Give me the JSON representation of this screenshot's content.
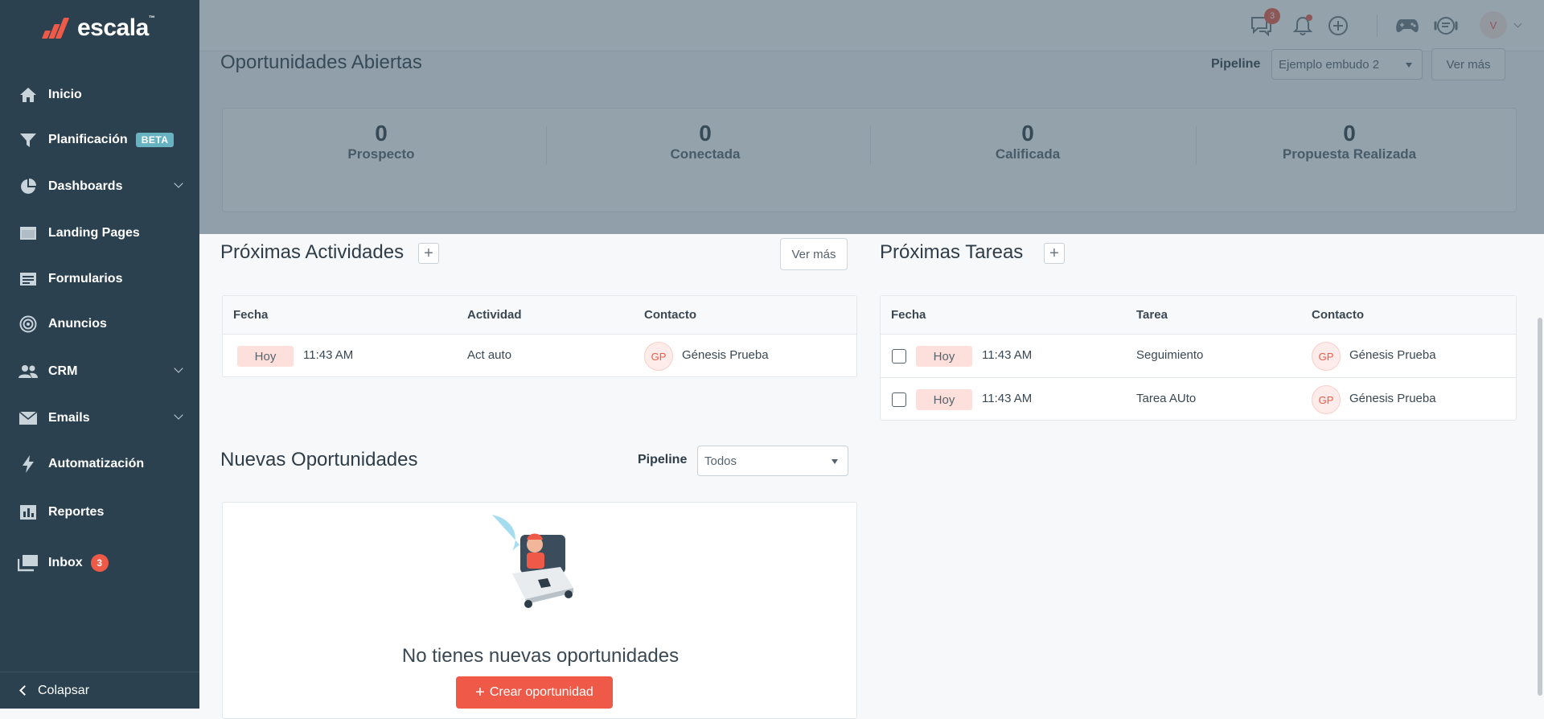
{
  "brand": {
    "logo_text": "escala",
    "logo_tm": "™"
  },
  "sidebar": {
    "items": [
      {
        "label": "Inicio",
        "icon": "home-icon"
      },
      {
        "label": "Planificación",
        "icon": "funnel-icon",
        "badge": "BETA"
      },
      {
        "label": "Dashboards",
        "icon": "pie-chart-icon",
        "chevron": true
      },
      {
        "label": "Landing Pages",
        "icon": "landing-page-icon"
      },
      {
        "label": "Formularios",
        "icon": "form-icon"
      },
      {
        "label": "Anuncios",
        "icon": "target-icon"
      },
      {
        "label": "CRM",
        "icon": "users-icon",
        "chevron": true
      },
      {
        "label": "Emails",
        "icon": "envelope-icon",
        "chevron": true
      },
      {
        "label": "Automatización",
        "icon": "bolt-icon"
      },
      {
        "label": "Reportes",
        "icon": "report-icon"
      },
      {
        "label": "Inbox",
        "icon": "inbox-icon",
        "count": "3"
      }
    ],
    "collapse_label": "Colapsar"
  },
  "topbar": {
    "chat_badge": "3",
    "avatar_initial": "V"
  },
  "open_opportunities": {
    "title": "Oportunidades Abiertas",
    "pipeline_label": "Pipeline",
    "pipeline_value": "Ejemplo embudo 2",
    "view_more": "Ver más",
    "stages": [
      {
        "count": "0",
        "label": "Prospecto"
      },
      {
        "count": "0",
        "label": "Conectada"
      },
      {
        "count": "0",
        "label": "Calificada"
      },
      {
        "count": "0",
        "label": "Propuesta Realizada"
      }
    ]
  },
  "activities": {
    "title": "Próximas Actividades",
    "view_more": "Ver más",
    "columns": [
      "Fecha",
      "Actividad",
      "Contacto"
    ],
    "rows": [
      {
        "day": "Hoy",
        "time": "11:43 AM",
        "name": "Act auto",
        "contact_initials": "GP",
        "contact": "Génesis Prueba"
      }
    ]
  },
  "tasks": {
    "title": "Próximas Tareas",
    "columns": [
      "Fecha",
      "Tarea",
      "Contacto"
    ],
    "rows": [
      {
        "day": "Hoy",
        "time": "11:43 AM",
        "name": "Seguimiento",
        "contact_initials": "GP",
        "contact": "Génesis Prueba"
      },
      {
        "day": "Hoy",
        "time": "11:43 AM",
        "name": "Tarea AUto",
        "contact_initials": "GP",
        "contact": "Génesis Prueba"
      }
    ]
  },
  "new_opportunities": {
    "title": "Nuevas Oportunidades",
    "pipeline_label": "Pipeline",
    "pipeline_value": "Todos",
    "empty_text": "No tienes nuevas oportunidades",
    "create_button": "Crear oportunidad"
  },
  "colors": {
    "sidebar": "#2b4150",
    "accent": "#ef5a48",
    "beta": "#67b3c2"
  }
}
